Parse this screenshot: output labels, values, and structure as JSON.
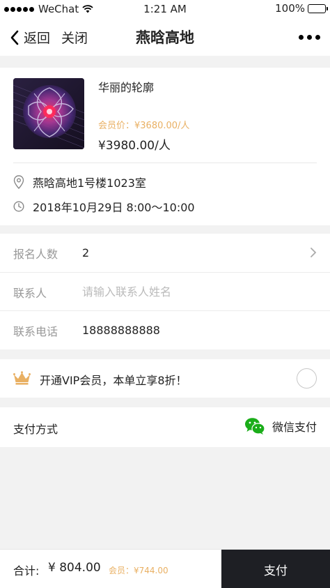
{
  "status_bar": {
    "carrier": "WeChat",
    "time": "1:21 AM",
    "battery": "100%",
    "battery_level": 1.0
  },
  "nav": {
    "back_label": "返回",
    "close_label": "关闭",
    "title": "燕晗高地"
  },
  "product": {
    "title": "华丽的轮廓",
    "member_price": "会员价：¥3680.00/人",
    "price": "¥3980.00/人",
    "location": "燕晗高地1号楼1023室",
    "datetime": "2018年10月29日  8:00～10:00"
  },
  "form": {
    "count_label": "报名人数",
    "count_value": "2",
    "contact_label": "联系人",
    "contact_placeholder": "请输入联系人姓名",
    "phone_label": "联系电话",
    "phone_value": "18888888888"
  },
  "vip": {
    "text": "开通VIP会员，本单立享8折！",
    "checked": false
  },
  "payment": {
    "label": "支付方式",
    "method": "微信支付"
  },
  "bottom": {
    "total_label": "合计:",
    "total_amount": "¥ 804.00",
    "member_total": "会员：¥744.00",
    "pay_button": "支付"
  },
  "icons": {
    "back": "chevron-left-icon",
    "more": "more-dots-icon",
    "location": "location-pin-icon",
    "clock": "clock-icon",
    "chevron": "chevron-right-icon",
    "crown": "crown-icon",
    "wechat": "wechat-pay-icon"
  },
  "colors": {
    "accent_gold": "#e9b063",
    "pay_button_bg": "#1e1f24",
    "wechat_green": "#1aad19"
  }
}
